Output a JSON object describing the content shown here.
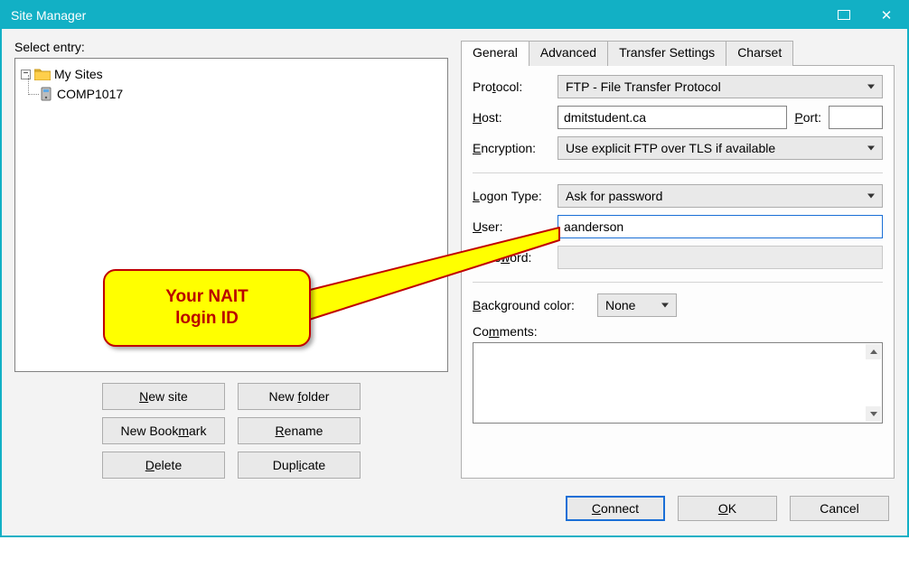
{
  "window": {
    "title": "Site Manager"
  },
  "left": {
    "select_entry_label": "Select entry:",
    "root_label": "My Sites",
    "site_label": "COMP1017"
  },
  "buttons": {
    "new_site": "New site",
    "new_folder": "New folder",
    "new_bookmark": "New Bookmark",
    "rename": "Rename",
    "delete": "Delete",
    "duplicate": "Duplicate"
  },
  "tabs": {
    "general": "General",
    "advanced": "Advanced",
    "transfer": "Transfer Settings",
    "charset": "Charset"
  },
  "general": {
    "protocol_label": "Protocol:",
    "protocol_value": "FTP - File Transfer Protocol",
    "host_label": "Host:",
    "host_value": "dmitstudent.ca",
    "port_label": "Port:",
    "port_value": "",
    "encryption_label": "Encryption:",
    "encryption_value": "Use explicit FTP over TLS if available",
    "logon_type_label": "Logon Type:",
    "logon_type_value": "Ask for password",
    "user_label": "User:",
    "user_value": "aanderson",
    "password_label": "Password:",
    "password_value": "",
    "bgcolor_label": "Background color:",
    "bgcolor_value": "None",
    "comments_label": "Comments:"
  },
  "dialog": {
    "connect": "Connect",
    "ok": "OK",
    "cancel": "Cancel"
  },
  "callout": {
    "line1": "Your NAIT",
    "line2": "login ID"
  }
}
